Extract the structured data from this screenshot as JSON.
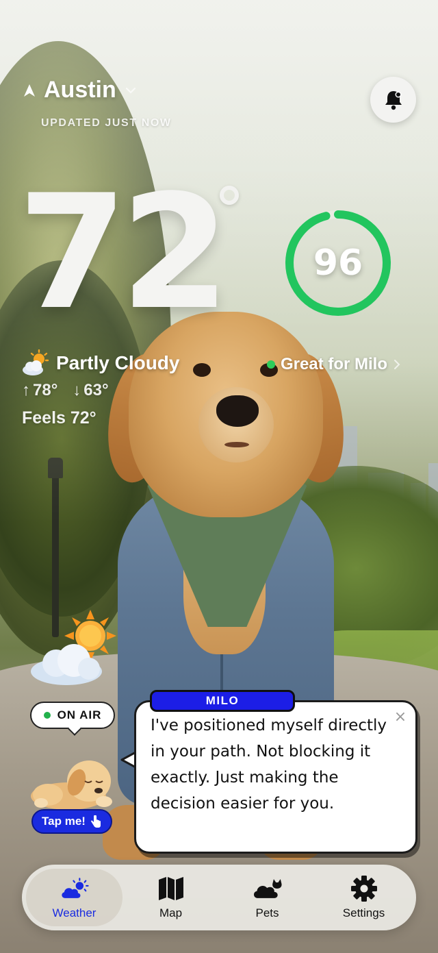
{
  "location": {
    "city": "Austin",
    "updated": "UPDATED JUST NOW"
  },
  "weather": {
    "temperature": "72",
    "condition": "Partly Cloudy",
    "high": "78°",
    "low": "63°",
    "feels": "Feels 72°",
    "condition_icon": "partly-cloudy-icon"
  },
  "score": {
    "value": "96",
    "fraction": 0.96,
    "color": "#22c55e"
  },
  "pet_status": {
    "text": "Great for Milo",
    "dot_color": "#2ecc5a"
  },
  "on_air": {
    "label": "ON AIR"
  },
  "tap_me": {
    "label": "Tap me!"
  },
  "bubble": {
    "speaker": "MILO",
    "close": "×",
    "message": "I've positioned myself directly in your path. Not blocking it exactly. Just making the decision easier for you."
  },
  "tabs": [
    {
      "label": "Weather",
      "icon": "weather-icon",
      "active": true
    },
    {
      "label": "Map",
      "icon": "map-icon",
      "active": false
    },
    {
      "label": "Pets",
      "icon": "pets-icon",
      "active": false
    },
    {
      "label": "Settings",
      "icon": "gear-icon",
      "active": false
    }
  ],
  "colors": {
    "accent": "#1a2be0",
    "score_ring": "#22c55e"
  }
}
